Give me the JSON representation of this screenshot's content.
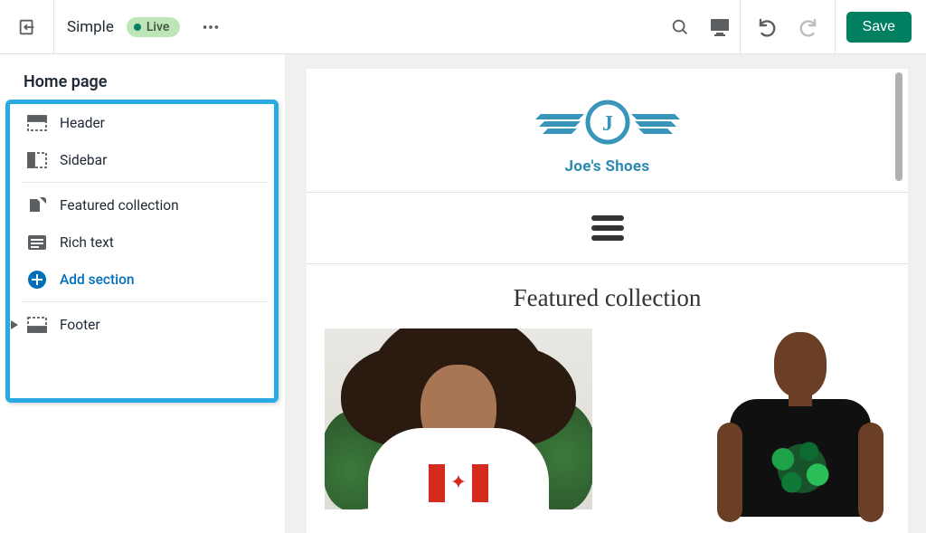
{
  "topbar": {
    "theme_name": "Simple",
    "status_label": "Live",
    "save_label": "Save"
  },
  "sidebar": {
    "page_title": "Home page",
    "items": {
      "header": "Header",
      "sidebarsec": "Sidebar",
      "featured": "Featured collection",
      "richtext": "Rich text",
      "addsection": "Add section",
      "footer": "Footer"
    }
  },
  "preview": {
    "store_name": "Joe's Shoes",
    "logo_letter": "J",
    "section_title": "Featured collection"
  }
}
